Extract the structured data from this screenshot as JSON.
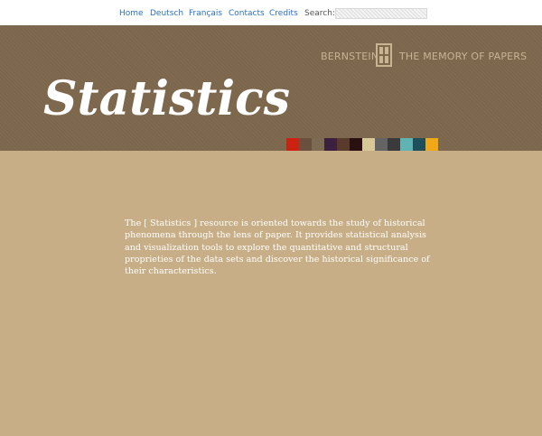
{
  "nav": {
    "items": [
      {
        "label": "Home"
      },
      {
        "label": "Deutsch"
      },
      {
        "label": "Français"
      },
      {
        "label": "Contacts"
      },
      {
        "label": "Credits"
      }
    ],
    "search_label": "Search:",
    "search_value": ""
  },
  "header": {
    "brand_left": "BERNSTEIN",
    "brand_right": "THE MEMORY OF PAPERS",
    "title": "Statistics",
    "swatch_colors": [
      "#cc2211",
      "#6b5040",
      "#7d6a52",
      "#3b2040",
      "#5a3a2a",
      "#2a1010",
      "#d8c898",
      "#646464",
      "#3a3a3a",
      "#5fb3b3",
      "#1f4f5a",
      "#f0a818"
    ]
  },
  "main": {
    "intro": "The [ Statistics ] resource is oriented towards the study of historical phenomena through the lens of paper. It provides statistical analysis and visualization tools to explore the quantitative and structural proprieties of the data sets and discover the historical significance of their characteristics."
  },
  "colors": {
    "page_bg": "#c8ae86",
    "header_bg": "#7f6a4f",
    "link": "#2a6fc9",
    "brand": "#c7b493"
  }
}
